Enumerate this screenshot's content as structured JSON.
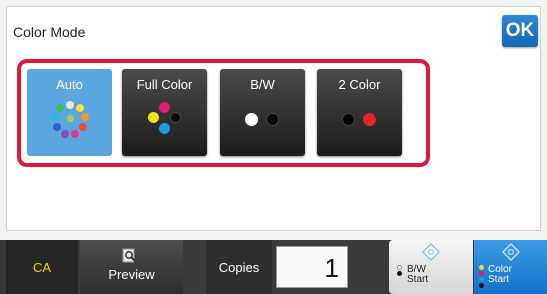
{
  "header": {
    "title": "Color Mode",
    "ok_label": "OK"
  },
  "modes": [
    {
      "label": "Auto",
      "selected": true
    },
    {
      "label": "Full Color",
      "selected": false
    },
    {
      "label": "B/W",
      "selected": false
    },
    {
      "label": "2 Color",
      "selected": false
    }
  ],
  "footer": {
    "ca_label": "CA",
    "preview_label": "Preview",
    "copies_label": "Copies",
    "copies_value": "1",
    "bw_start_line1": "B/W",
    "bw_start_line2": "Start",
    "color_start_line1": "Color",
    "color_start_line2": "Start"
  },
  "colors": {
    "accent": "#1565b3",
    "selected_mode": "#5aa6df",
    "highlight": "#e0193a",
    "ca_text": "#f0d400"
  }
}
